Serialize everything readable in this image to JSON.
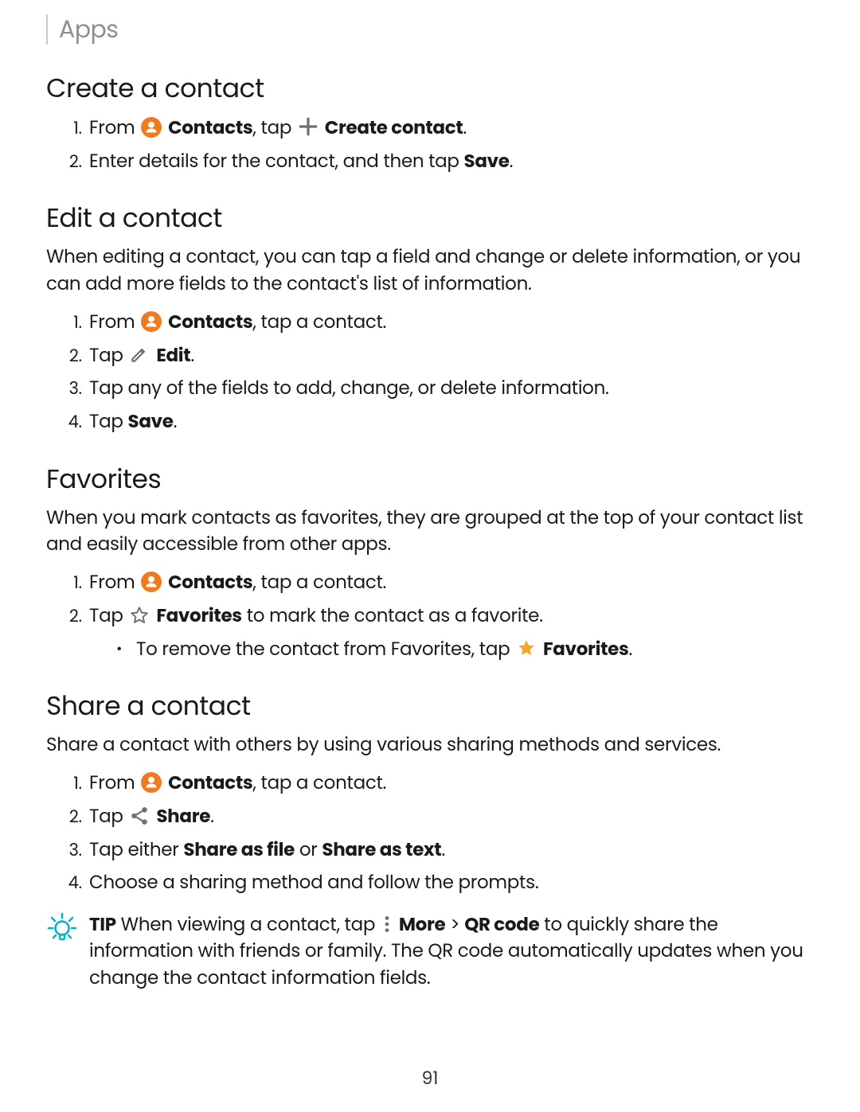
{
  "header": {
    "breadcrumb": "Apps"
  },
  "create": {
    "heading": "Create a contact",
    "step1_from": "From",
    "step1_contacts": "Contacts",
    "step1_tap": ", tap",
    "step1_create": "Create contact",
    "step1_end": ".",
    "step2_a": "Enter details for the contact, and then tap ",
    "step2_save": "Save",
    "step2_end": "."
  },
  "edit": {
    "heading": "Edit a contact",
    "intro": "When editing a contact, you can tap a field and change or delete information, or you can add more fields to the contact's list of information.",
    "step1_from": "From",
    "step1_contacts": "Contacts",
    "step1_end": ", tap a contact.",
    "step2_tap": "Tap",
    "step2_edit": "Edit",
    "step2_end": ".",
    "step3": "Tap any of the fields to add, change, or delete information.",
    "step4_a": "Tap ",
    "step4_save": "Save",
    "step4_end": "."
  },
  "favorites": {
    "heading": "Favorites",
    "intro": "When you mark contacts as favorites, they are grouped at the top of your contact list and easily accessible from other apps.",
    "step1_from": "From",
    "step1_contacts": "Contacts",
    "step1_end": ", tap a contact.",
    "step2_tap": "Tap",
    "step2_fav": "Favorites",
    "step2_end": " to mark the contact as a favorite.",
    "sub_a": "To remove the contact from Favorites, tap",
    "sub_fav": "Favorites",
    "sub_end": "."
  },
  "share": {
    "heading": "Share a contact",
    "intro": "Share a contact with others by using various sharing methods and services.",
    "step1_from": "From",
    "step1_contacts": "Contacts",
    "step1_end": ", tap a contact.",
    "step2_tap": "Tap",
    "step2_share": "Share",
    "step2_end": ".",
    "step3_a": "Tap either ",
    "step3_file": "Share as file",
    "step3_or": " or ",
    "step3_text": "Share as text",
    "step3_end": ".",
    "step4": "Choose a sharing method and follow the prompts."
  },
  "tip": {
    "label": "TIP",
    "a": "  When viewing a contact, tap",
    "more": "More",
    "gt": " > ",
    "qr": "QR code",
    "b": " to quickly share the information with friends or family. The QR code automatically updates when you change the contact information fields."
  },
  "page_number": "91"
}
